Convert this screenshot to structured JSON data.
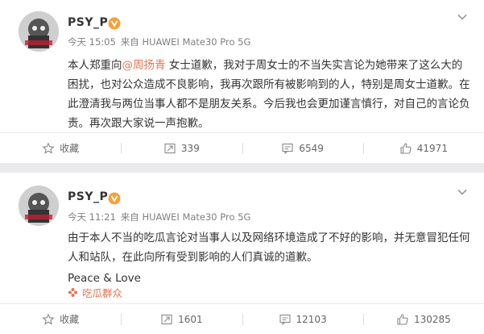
{
  "colors": {
    "accent": "#eb7350",
    "text": "#333333",
    "meta": "#808080",
    "background": "#eaeaec"
  },
  "posts": [
    {
      "username": "PSY_P",
      "meta_time": "今天 15:05",
      "meta_source": "来自 HUAWEI Mate30 Pro 5G",
      "content_prefix": "本人郑重向",
      "content_mention": "@周扬青",
      "content_suffix": " 女士道歉，我对于周女士的不当失实言论为她带来了这么大的困扰，也对公众造成不良影响，我再次跟所有被影响到的人，特别是周女士道歉。在此澄清我与两位当事人都不是朋友关系。今后我也会更加谨言慎行，对自己的言论负责。再次跟大家说一声抱歉。",
      "actions": {
        "favorite": "收藏",
        "repost": "339",
        "comment": "6549",
        "like": "41971"
      }
    },
    {
      "username": "PSY_P",
      "meta_time": "今天 11:21",
      "meta_source": "来自 HUAWEI Mate30 Pro 5G",
      "content_line1": "由于本人不当的吃瓜言论对当事人以及网络环境造成了不好的影响，并无意冒犯任何人和站队，在此向所有受到影响的人们真诚的道歉。",
      "content_line2": "Peace & Love",
      "topic": "吃瓜群众",
      "actions": {
        "favorite": "收藏",
        "repost": "1601",
        "comment": "12103",
        "like": "130285"
      }
    }
  ],
  "icons": {
    "avatar": "avatar-image",
    "vip": "vip-badge-icon",
    "chevron": "chevron-down-icon",
    "favorite": "star-icon",
    "repost": "repost-icon",
    "comment": "comment-icon",
    "like": "thumbs-up-icon",
    "topic": "topic-icon"
  }
}
